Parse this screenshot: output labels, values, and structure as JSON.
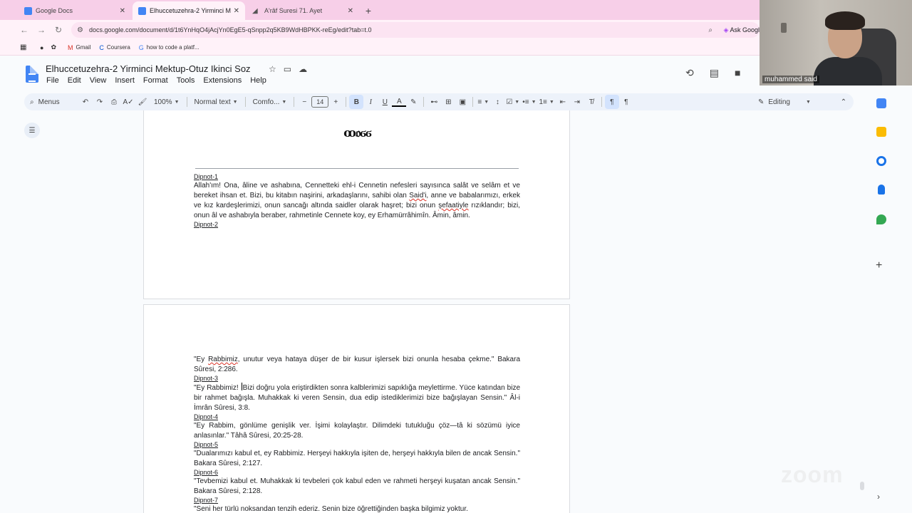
{
  "browser": {
    "tabs": [
      {
        "title": "Google Docs",
        "active": false
      },
      {
        "title": "Elhuccetuzehra-2 Yirminci Mekt",
        "active": true
      },
      {
        "title": "A'râf Suresi 71. Ayet",
        "active": false
      }
    ],
    "url": "docs.google.com/document/d/1t6YnHqO4jAcjYn0EgE5-qSnpp2q5KB9WdHBPKK-reEg/edit?tab=t.0",
    "ask_google": "Ask Googl",
    "bookmarks": [
      "Gmail",
      "Coursera",
      "how to code a platf..."
    ]
  },
  "docs": {
    "title": "Elhuccetuzehra-2 Yirminci Mektup-Otuz Ikinci Soz",
    "menu": [
      "File",
      "Edit",
      "View",
      "Insert",
      "Format",
      "Tools",
      "Extensions",
      "Help"
    ],
    "toolbar": {
      "menus": "Menus",
      "zoom": "100%",
      "style": "Normal text",
      "font": "Comfo...",
      "font_size": "14",
      "mode": "Editing"
    }
  },
  "page1": {
    "ornament": "ꝏ𝔬ϭϭ",
    "footnote1_label": "Dipnot-1",
    "footnote1_text_a": "Allah'ım! Ona, âline ve ashabına, Cennetteki ehl-i Cennetin nefesleri sayısınca salât ve selâm et ve bereket ihsan et. Bizi, bu kitabın naşirini, arkadaşlarını, sahibi olan ",
    "footnote1_said": "Said'i",
    "footnote1_text_b": ", anne ve babalarımızı, erkek ve kız kardeşlerimizi, onun sancağı altında saidler olarak haşret; bizi onun ",
    "footnote1_sefaat": "şefaatiyle",
    "footnote1_text_c": " rızıklandır; bizi, onun âl ve ashabıyla beraber, rahmetinle Cennete koy, ey Erhamürrâhimîn. Âmin, âmin.",
    "footnote2_label": "Dipnot-2"
  },
  "page2": {
    "p1_a": "\"Ey ",
    "p1_rabbimiz": "Rabbimiz",
    "p1_b": ", unutur veya hataya düşer de bir kusur işlersek bizi onunla hesaba çekme.\" Bakara Sûresi, 2:286.",
    "fn3": "Dipnot-3",
    "p2_a": "\"Ey Rabbimiz! ",
    "p2_b": "Bizi doğru yola eriştirdikten sonra kalblerimizi sapıklığa meylettirme. Yüce katından bize bir rahmet bağışla. Muhakkak ki veren Sensin, dua edip istediklerimizi bize bağışlayan Sensin.\" Âl-i İmrân Sûresi, 3:8.",
    "fn4": "Dipnot-4",
    "p3": "\"Ey Rabbim, gönlüme genişlik ver. İşimi kolaylaştır. Dilimdeki tutukluğu çöz—tâ ki sözümü iyice anlasınlar.\" Tâhâ Sûresi, 20:25-28.",
    "fn5": "Dipnot-5",
    "p4": "\"Dualarımızı kabul et, ey Rabbimiz. Herşeyi hakkıyla işiten de, herşeyi hakkıyla bilen de ancak Sensin.\" Bakara Sûresi, 2:127.",
    "fn6": "Dipnot-6",
    "p5": "\"Tevbemizi kabul et. Muhakkak ki tevbeleri çok kabul eden ve rahmeti herşeyi kuşatan ancak Sensin.\" Bakara Sûresi, 2:128.",
    "fn7": "Dipnot-7",
    "p6": "\"Seni her türlü noksandan tenzih ederiz. Senin bize öğrettiğinden başka bilgimiz yoktur."
  },
  "webcam": {
    "name": "muhammed said"
  },
  "watermark": "zoom",
  "colors": {
    "tab_strip": "#f7cfe8",
    "docs_blue": "#4285f4",
    "toolbar_bg": "#edf2fa",
    "bold_active": "#d3e3fd"
  }
}
